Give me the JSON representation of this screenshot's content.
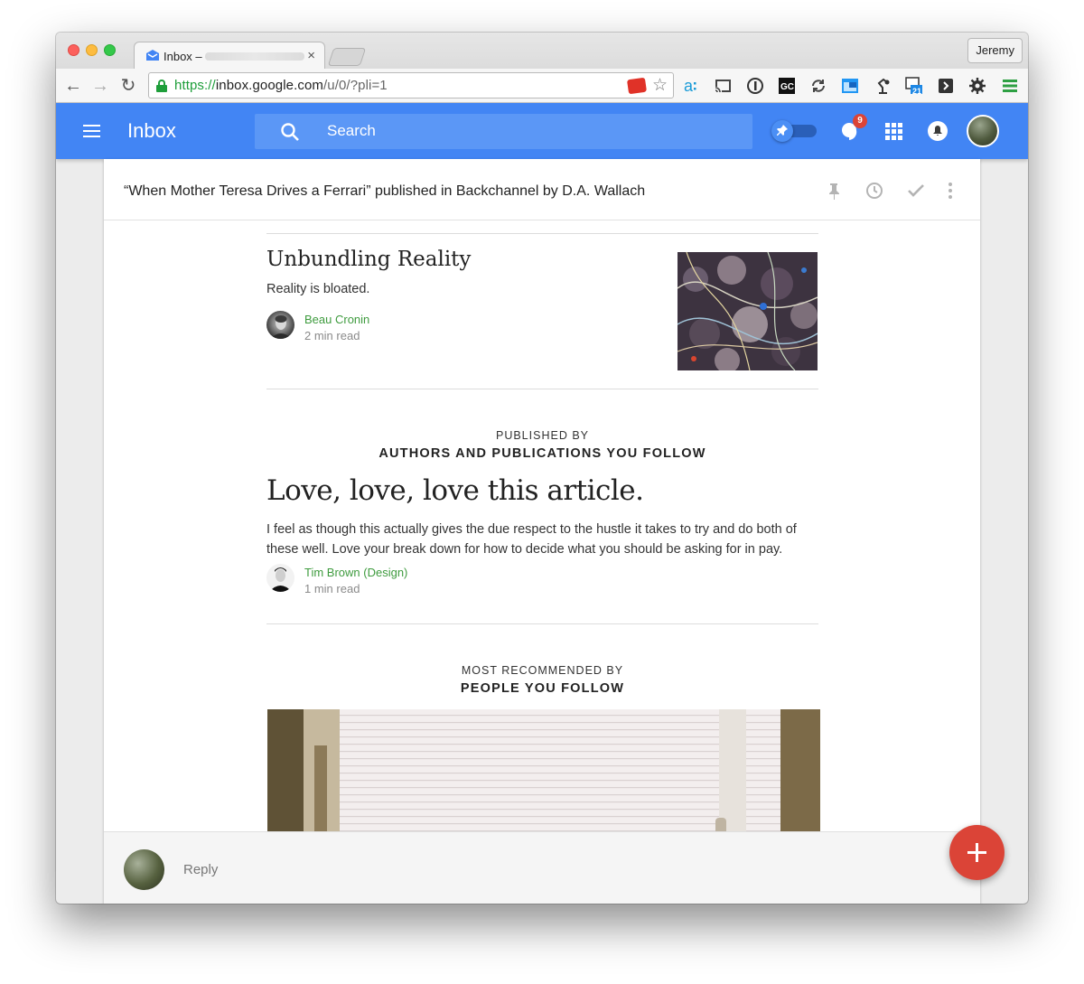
{
  "browser": {
    "tab": {
      "title": "Inbox –",
      "close_glyph": "×"
    },
    "profile_name": "Jeremy",
    "nav": {
      "back": "←",
      "forward": "→",
      "reload": "↻"
    },
    "url": {
      "scheme": "https://",
      "host": "inbox.google.com",
      "path": "/u/0/?pli=1"
    },
    "star_glyph": "☆",
    "extensions": [
      "amazon-assistant-icon",
      "cast-icon",
      "onepassword-icon",
      "gc-icon",
      "sync-icon",
      "window-icon",
      "lamp-icon",
      "calendar-icon",
      "pocket-icon",
      "gear-icon",
      "menu-icon"
    ],
    "calendar_ext_badge": "21"
  },
  "app": {
    "title": "Inbox",
    "search": {
      "placeholder": "Search"
    },
    "notification_badge": "9",
    "accent": "#4285f4"
  },
  "message": {
    "subject": "“When Mother Teresa Drives a Ferrari” published in Backchannel by D.A. Wallach",
    "story1": {
      "title": "Unbundling Reality",
      "subtitle": "Reality is bloated.",
      "author": "Beau Cronin",
      "read_time": "2 min read"
    },
    "section1": {
      "caption": "PUBLISHED BY",
      "heading": "AUTHORS AND PUBLICATIONS YOU FOLLOW"
    },
    "story2": {
      "title": "Love, love, love this article.",
      "body": "I feel as though this actually gives the due respect to the hustle it takes to try and do both of these well. Love your break down for how to decide what you should be asking for in pay.",
      "author": "Tim Brown (Design)",
      "read_time": "1 min read"
    },
    "section2": {
      "caption": "MOST RECOMMENDED BY",
      "heading": "PEOPLE YOU FOLLOW"
    }
  },
  "reply": {
    "label": "Reply"
  },
  "fab": {
    "color": "#db4437"
  }
}
